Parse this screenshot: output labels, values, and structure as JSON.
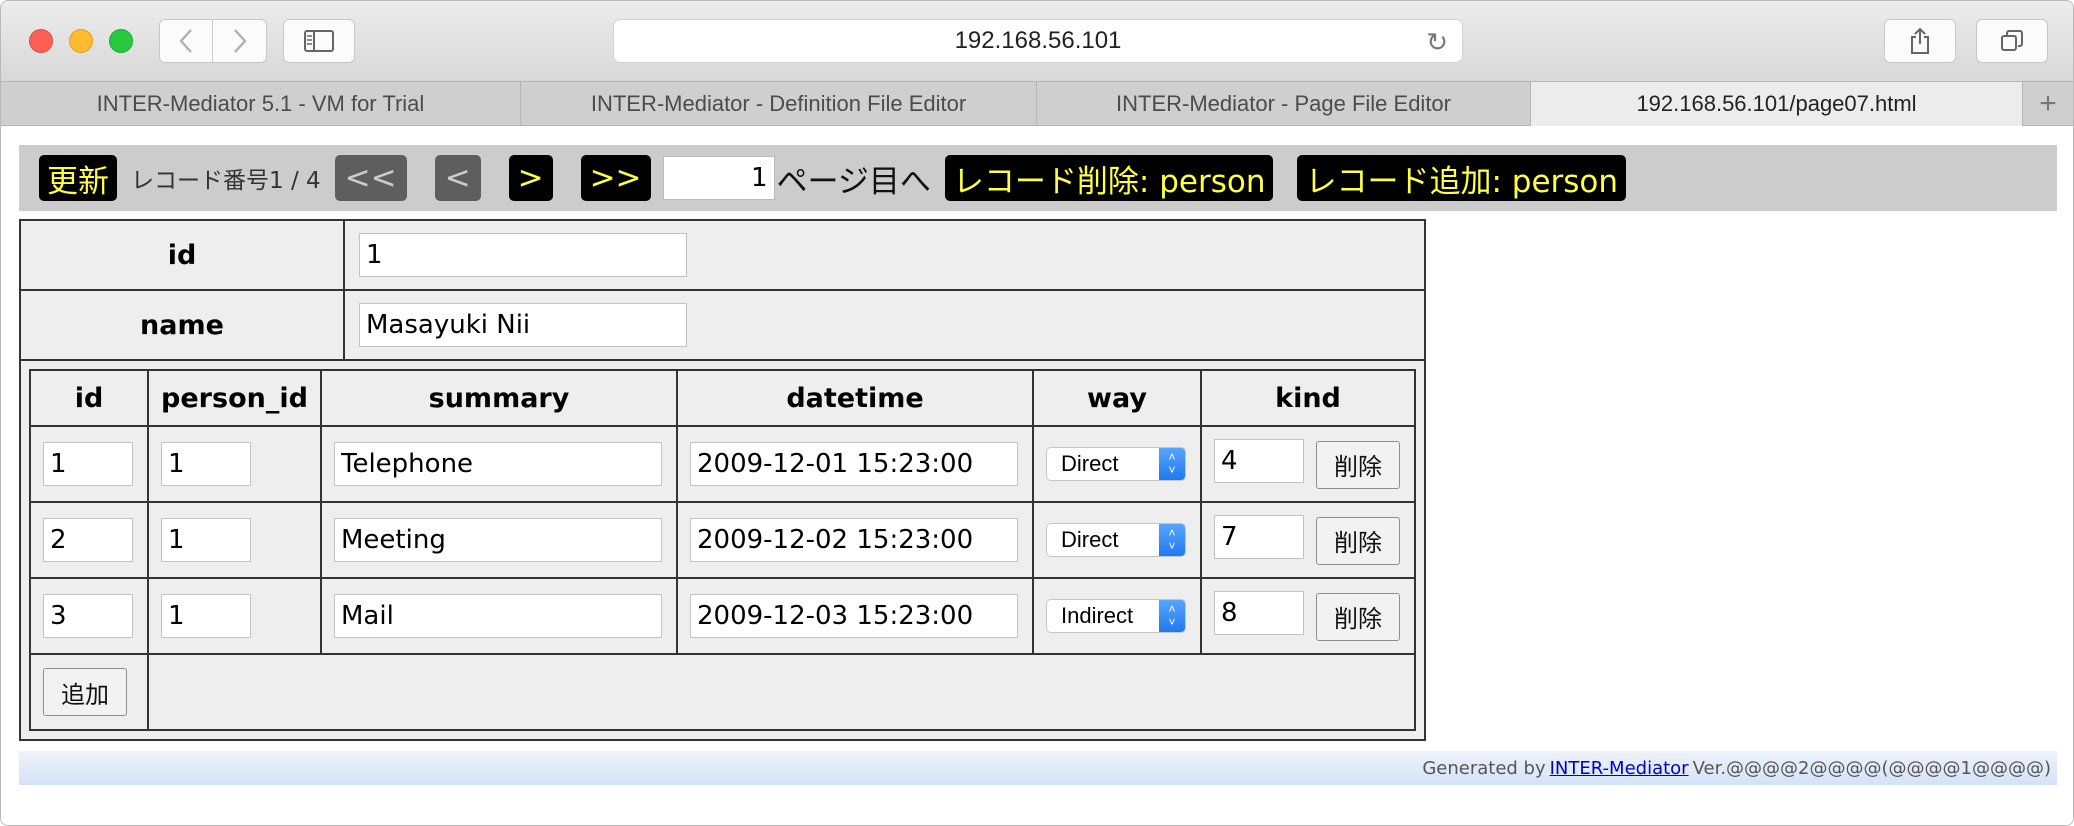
{
  "browser": {
    "url": "192.168.56.101",
    "tabs": [
      "INTER-Mediator 5.1 - VM for Trial",
      "INTER-Mediator - Definition File Editor",
      "INTER-Mediator - Page File Editor",
      "192.168.56.101/page07.html"
    ],
    "new_tab_label": "+"
  },
  "navigation": {
    "refresh": "更新",
    "record_info": "レコード番号1 / 4",
    "first": "<<",
    "prev": "<",
    "next": ">",
    "last": ">>",
    "page_value": "1",
    "page_suffix": "ページ目へ",
    "delete_record": "レコード削除: person",
    "add_record": "レコード追加: person"
  },
  "record": {
    "id_label": "id",
    "id_value": "1",
    "name_label": "name",
    "name_value": "Masayuki Nii"
  },
  "contact_table": {
    "headers": [
      "id",
      "person_id",
      "summary",
      "datetime",
      "way",
      "kind"
    ],
    "rows": [
      {
        "id": "1",
        "person_id": "1",
        "summary": "Telephone",
        "datetime": "2009-12-01 15:23:00",
        "way": "Direct",
        "kind": "4",
        "delete": "削除"
      },
      {
        "id": "2",
        "person_id": "1",
        "summary": "Meeting",
        "datetime": "2009-12-02 15:23:00",
        "way": "Direct",
        "kind": "7",
        "delete": "削除"
      },
      {
        "id": "3",
        "person_id": "1",
        "summary": "Mail",
        "datetime": "2009-12-03 15:23:00",
        "way": "Indirect",
        "kind": "8",
        "delete": "削除"
      }
    ],
    "add_label": "追加"
  },
  "footer": {
    "prefix": "Generated by",
    "link": "INTER-Mediator",
    "suffix": "Ver.@@@@2@@@@(@@@@1@@@@)"
  },
  "colors": {
    "button_bg": "#000000",
    "button_text": "#ffff44",
    "disabled_button_bg": "#5e5e5e",
    "nav_strip_bg": "#cccccc",
    "table_bg": "#eeeeee",
    "footer_bg": "#d4e2f7"
  }
}
